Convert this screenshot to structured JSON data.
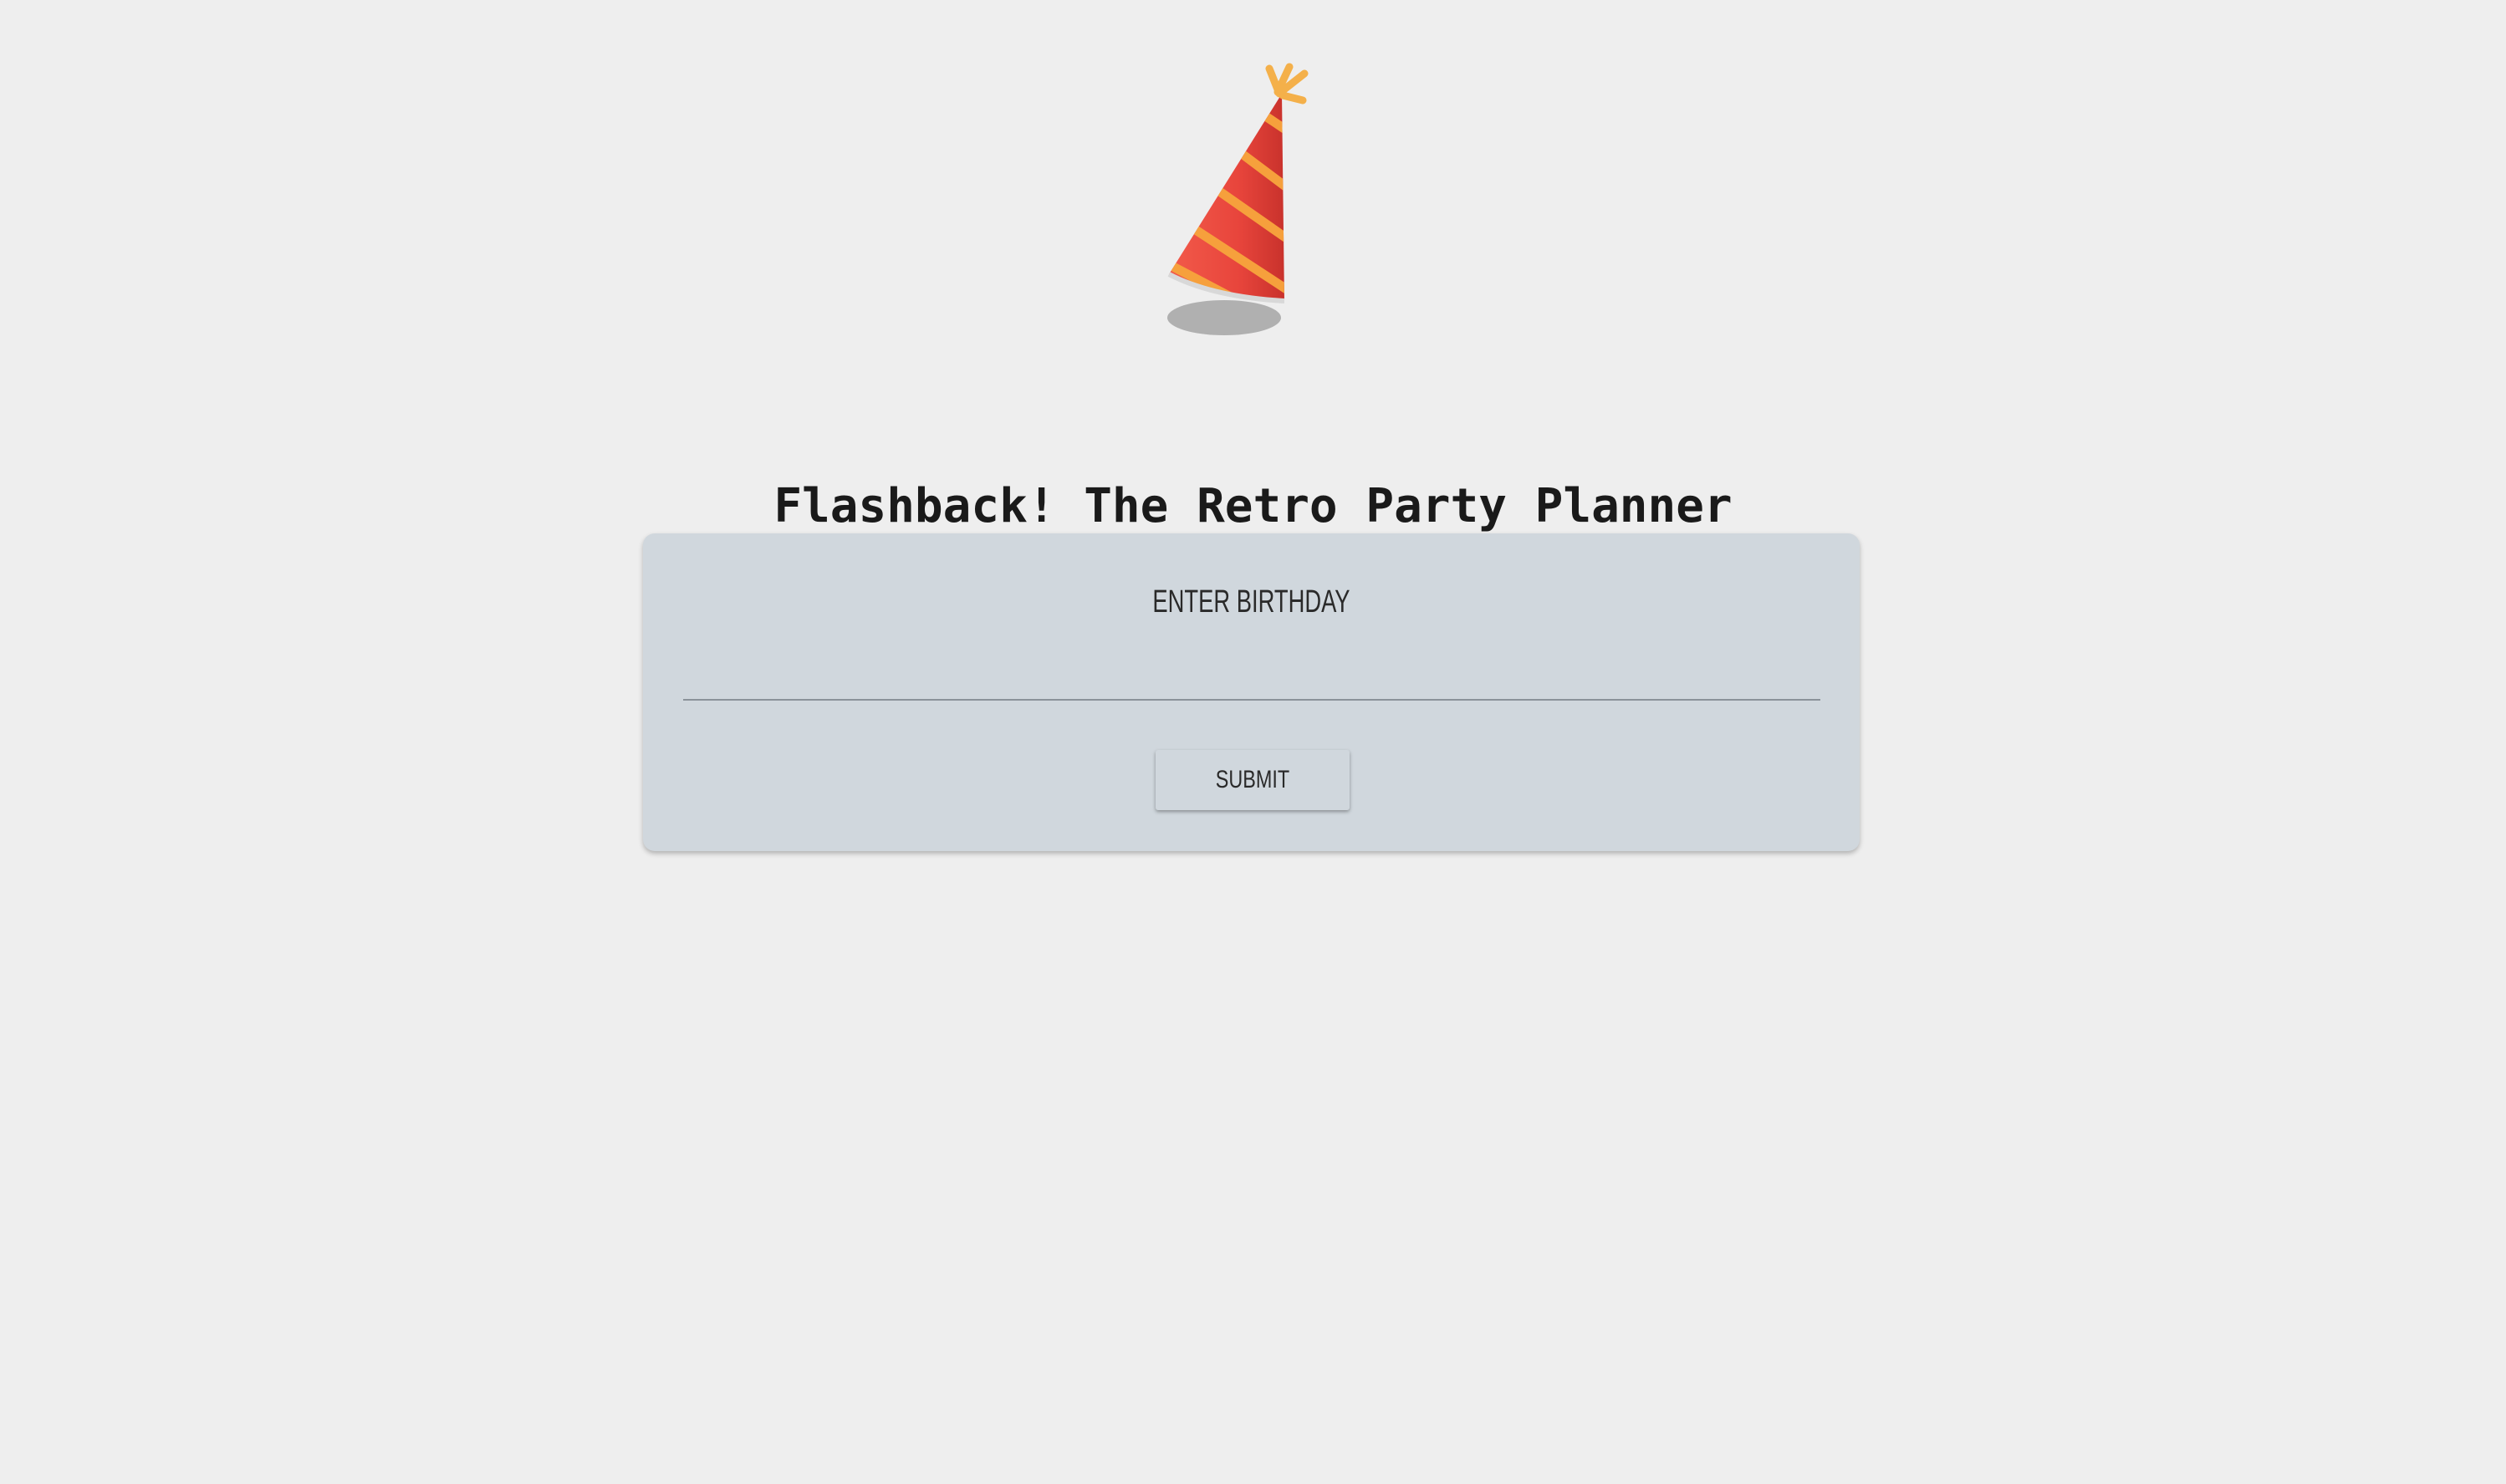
{
  "header": {
    "logo_icon": "party-hat-icon",
    "title": "Flashback! The Retro Party Planner"
  },
  "form": {
    "label": "ENTER BIRTHDAY",
    "input_value": "",
    "input_placeholder": "",
    "submit_label": "SUBMIT"
  },
  "colors": {
    "background": "#eeeeee",
    "card": "#d0d7dd",
    "hat_red": "#e8453c",
    "hat_stripe": "#f6a03c",
    "hat_shadow": "#b0b0b0",
    "text": "#1a1a1a"
  }
}
